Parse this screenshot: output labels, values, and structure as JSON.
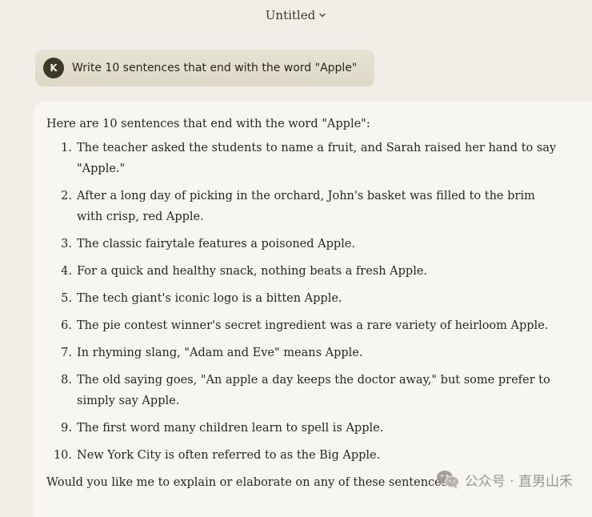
{
  "header": {
    "title": "Untitled"
  },
  "user_message": {
    "avatar_initial": "K",
    "text": "Write 10 sentences that end with the word \"Apple\""
  },
  "assistant_message": {
    "intro": "Here are 10 sentences that end with the word \"Apple\":",
    "items": [
      {
        "number": "1.",
        "text": "The teacher asked the students to name a fruit, and Sarah raised her hand to say \"Apple.\""
      },
      {
        "number": "2.",
        "text": "After a long day of picking in the orchard, John's basket was filled to the brim with crisp, red Apple."
      },
      {
        "number": "3.",
        "text": "The classic fairytale features a poisoned Apple."
      },
      {
        "number": "4.",
        "text": "For a quick and healthy snack, nothing beats a fresh Apple."
      },
      {
        "number": "5.",
        "text": "The tech giant's iconic logo is a bitten Apple."
      },
      {
        "number": "6.",
        "text": "The pie contest winner's secret ingredient was a rare variety of heirloom Apple."
      },
      {
        "number": "7.",
        "text": "In rhyming slang, \"Adam and Eve\" means Apple."
      },
      {
        "number": "8.",
        "text": "The old saying goes, \"An apple a day keeps the doctor away,\" but some prefer to simply say Apple."
      },
      {
        "number": "9.",
        "text": "The first word many children learn to spell is Apple."
      },
      {
        "number": "10.",
        "text": "New York City is often referred to as the Big Apple."
      }
    ],
    "closing": "Would you like me to explain or elaborate on any of these sentences?"
  },
  "watermark": {
    "icon": "wechat-icon",
    "text": "公众号 · 直男山禾"
  },
  "colors": {
    "background": "#f0eee6",
    "card": "#f7f6f2",
    "user_bubble": "#e3dfcf",
    "avatar": "#3d3929",
    "text": "#29261b"
  }
}
